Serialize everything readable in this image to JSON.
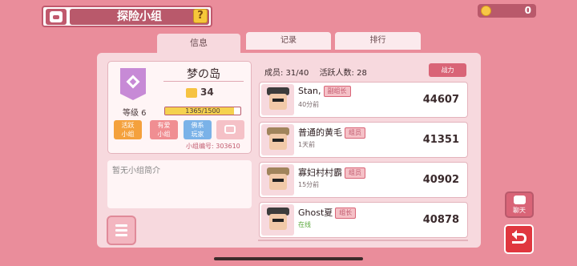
{
  "header": {
    "title": "探险小组",
    "help_label": "?"
  },
  "coins": {
    "value": "0"
  },
  "tabs": [
    {
      "label": "信息"
    },
    {
      "label": "记录"
    },
    {
      "label": "排行"
    }
  ],
  "group": {
    "name": "梦の岛",
    "score": "34",
    "level": "等级 6",
    "exp_text": "1365/1500",
    "exp_fraction": 0.91,
    "tags": [
      {
        "line1": "活跃",
        "line2": "小组"
      },
      {
        "line1": "有爱",
        "line2": "小组"
      },
      {
        "line1": "佛系",
        "line2": "玩家"
      },
      {
        "line1": "",
        "line2": ""
      }
    ],
    "id_text": "小组编号: 303610",
    "description": "暂无小组简介"
  },
  "members_summary": {
    "count_text": "成员: 31/40",
    "active_text": "活跃人数: 28",
    "power_button": "战力"
  },
  "members": [
    {
      "name": "Stan,",
      "role": "副组长",
      "time": "40分前",
      "power": "44607",
      "hat": "dark"
    },
    {
      "name": "普通的黄毛",
      "role": "组员",
      "time": "1天前",
      "power": "41351",
      "hat": "khaki"
    },
    {
      "name": "寡妇村村霸",
      "role": "组员",
      "time": "15分前",
      "power": "40902",
      "hat": "khaki"
    },
    {
      "name": "Ghost夏",
      "role": "组长",
      "time": "在线",
      "power": "40878",
      "hat": "dark"
    }
  ],
  "side": {
    "chat_label": "聊天"
  }
}
